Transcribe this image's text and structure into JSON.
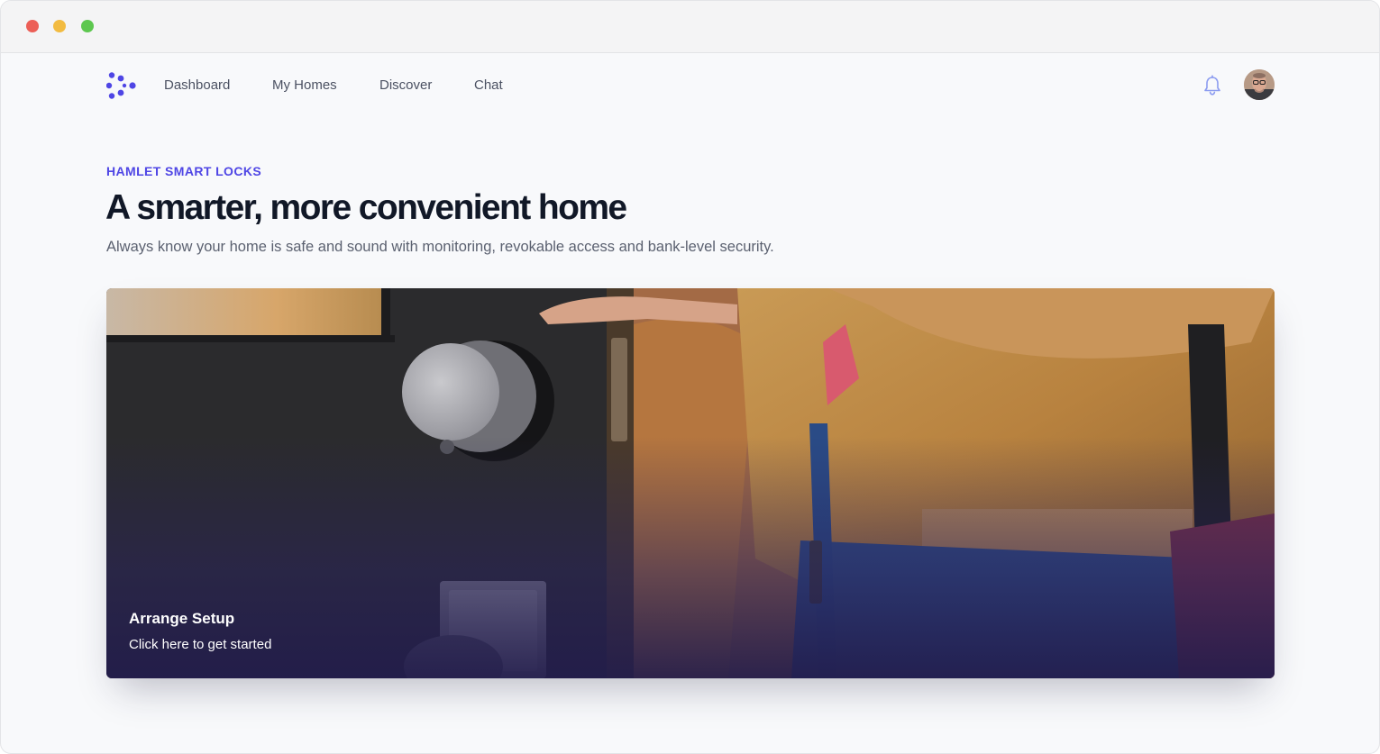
{
  "window": {
    "controls": [
      "close",
      "minimize",
      "maximize"
    ]
  },
  "nav": {
    "logo_icon": "brand-asterisk-logo",
    "links": [
      {
        "label": "Dashboard"
      },
      {
        "label": "My Homes"
      },
      {
        "label": "Discover"
      },
      {
        "label": "Chat"
      }
    ],
    "notifications_icon": "bell-icon",
    "avatar_icon": "user-avatar"
  },
  "hero_header": {
    "eyebrow": "HAMLET SMART LOCKS",
    "title": "A smarter, more convenient home",
    "subtitle": "Always know your home is safe and sound with monitoring, revokable access and bank-level security."
  },
  "feature_card": {
    "title": "Arrange Setup",
    "subtitle": "Click here to get started",
    "image_subject": "smart-lock-on-door-photo"
  },
  "colors": {
    "accent": "#4f46e5",
    "heading": "#111827",
    "body_text": "#5b6170"
  }
}
